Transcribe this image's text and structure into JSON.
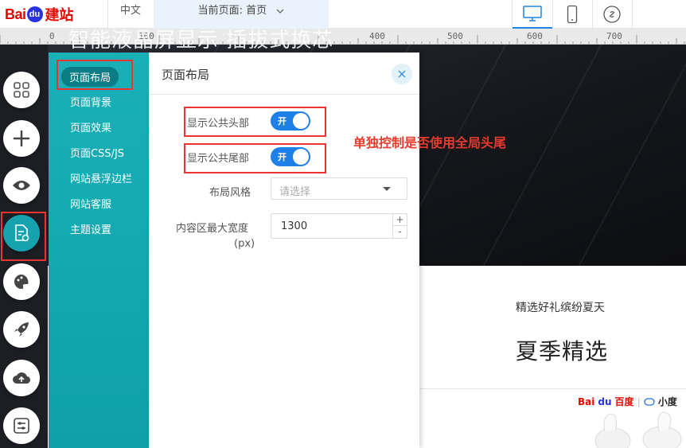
{
  "topbar": {
    "logo": {
      "bai": "Bai",
      "du": "du",
      "jianzhan": "建站"
    },
    "language": "中文",
    "current_page": "当前页面: 首页",
    "devices": [
      "desktop",
      "mobile",
      "link"
    ]
  },
  "ruler": {
    "ticks": [
      "0",
      "100",
      "400",
      "500",
      "600",
      "700"
    ]
  },
  "canvas": {
    "banner_text": "智能液晶屏显示 插拔式换芯",
    "subtitle": "精选好礼缤纷夏天",
    "title": "夏季精选",
    "brand_baidu": "Bai",
    "brand_du": "du",
    "brand_baidu_cn": "百度",
    "brand_xiaodu": "小度"
  },
  "dock": {
    "buttons": [
      "grid-icon",
      "plus-icon",
      "eye-icon",
      "page-settings-icon",
      "palette-icon",
      "rocket-icon",
      "cloud-upload-icon",
      "sliders-icon"
    ]
  },
  "nav": {
    "items": [
      {
        "label": "页面布局"
      },
      {
        "label": "页面背景"
      },
      {
        "label": "页面效果"
      },
      {
        "label": "页面CSS/JS"
      },
      {
        "label": "网站悬浮边栏"
      },
      {
        "label": "网站客服"
      },
      {
        "label": "主题设置"
      }
    ]
  },
  "settings": {
    "title": "页面布局",
    "show_header_label": "显示公共头部",
    "show_header_toggle": "开",
    "show_footer_label": "显示公共尾部",
    "show_footer_toggle": "开",
    "layout_style_label": "布局风格",
    "layout_style_placeholder": "请选择",
    "max_width_label_1": "内容区最大宽度",
    "max_width_label_2": "(px)",
    "max_width_value": "1300",
    "stepper_up": "+",
    "stepper_down": "-"
  },
  "annotation": "单独控制是否使用全局头尾",
  "colors": {
    "accent": "#1f7fe8",
    "teal": "#12a7b3",
    "annotation_red": "#e53b2c"
  }
}
